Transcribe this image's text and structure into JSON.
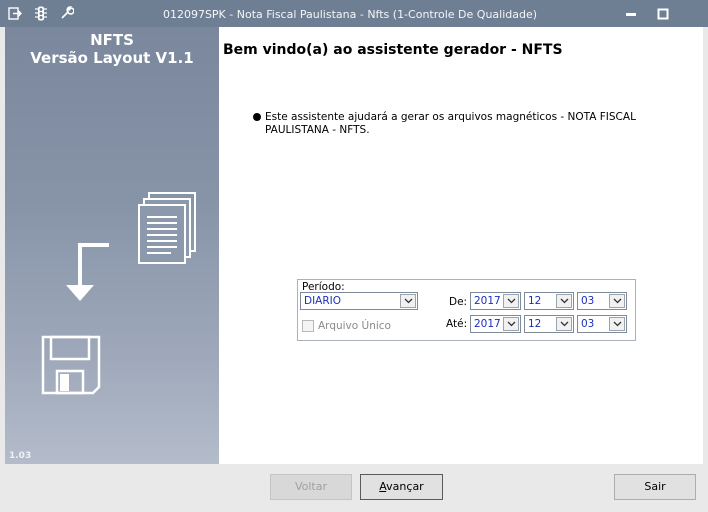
{
  "window": {
    "title": "012097SPK - Nota Fiscal Paulistana - Nfts (1-Controle De Qualidade)",
    "icons": [
      "exit-icon",
      "traffic-light-icon",
      "wrench-icon"
    ],
    "controls": [
      "minimize-icon",
      "maximize-icon"
    ]
  },
  "sidebar": {
    "app_name": "NFTS",
    "app_version": "Versão Layout V1.1",
    "build": "1.03"
  },
  "content": {
    "heading": "Bem vindo(a) ao assistente gerador - NFTS",
    "description": "Este assistente ajudará a gerar os arquivos magnéticos - NOTA FISCAL PAULISTANA - NFTS."
  },
  "period": {
    "label": "Período:",
    "type_value": "DIARIO",
    "single_file_label": "Arquivo Único",
    "from_label": "De:",
    "to_label": "Até:",
    "from": {
      "year": "2017",
      "month": "12",
      "day": "03"
    },
    "to": {
      "year": "2017",
      "month": "12",
      "day": "03"
    }
  },
  "buttons": {
    "back": "Voltar",
    "next_prefix": "A",
    "next_rest": "vançar",
    "exit": "Sair"
  }
}
